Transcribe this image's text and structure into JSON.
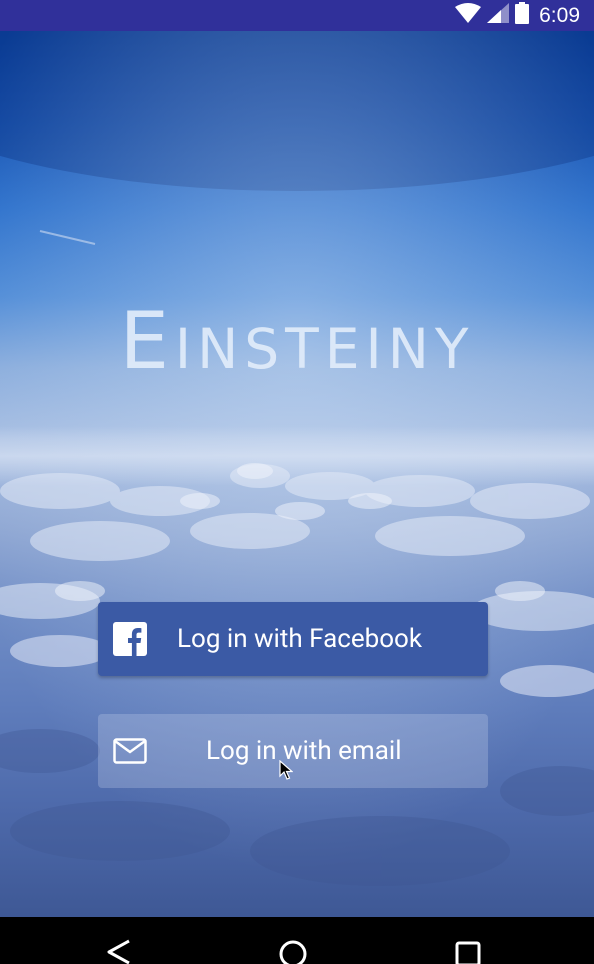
{
  "status_bar": {
    "time": "6:09",
    "icons": [
      "wifi-icon",
      "signal-icon",
      "battery-icon"
    ],
    "background": "#30309a"
  },
  "app": {
    "title": "Einsteiny"
  },
  "login": {
    "facebook_label": "Log in with Facebook",
    "facebook_icon": "facebook-icon",
    "facebook_color": "#3b5aa5",
    "email_label": "Log in with email",
    "email_icon": "mail-icon"
  },
  "nav_bar": {
    "buttons": [
      "back-icon",
      "home-icon",
      "recents-icon"
    ]
  }
}
